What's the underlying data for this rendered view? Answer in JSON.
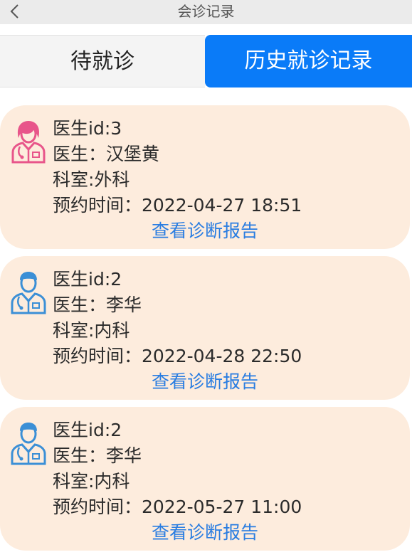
{
  "header": {
    "title": "会诊记录",
    "back_icon": "chevron-left-icon"
  },
  "tabs": [
    {
      "label": "待就诊",
      "active": false
    },
    {
      "label": "历史就诊记录",
      "active": true
    }
  ],
  "colors": {
    "active_tab": "#0a7bf8",
    "card_bg": "#fdecdd",
    "link": "#2a7de1",
    "female_doctor_icon": "#e8558a",
    "male_doctor_icon": "#3b8fd6"
  },
  "records": [
    {
      "avatar_icon": "female-doctor-icon",
      "doctor_id": "医生id:3",
      "doctor_name": "医生：汉堡黄",
      "department": "科室:外科",
      "appointment_time": "预约时间：2022-04-27 18:51",
      "report_link": "查看诊断报告"
    },
    {
      "avatar_icon": "male-doctor-icon",
      "doctor_id": "医生id:2",
      "doctor_name": "医生：李华",
      "department": "科室:内科",
      "appointment_time": "预约时间：2022-04-28 22:50",
      "report_link": "查看诊断报告"
    },
    {
      "avatar_icon": "male-doctor-icon",
      "doctor_id": "医生id:2",
      "doctor_name": "医生：李华",
      "department": "科室:内科",
      "appointment_time": "预约时间：2022-05-27 11:00",
      "report_link": "查看诊断报告"
    }
  ]
}
